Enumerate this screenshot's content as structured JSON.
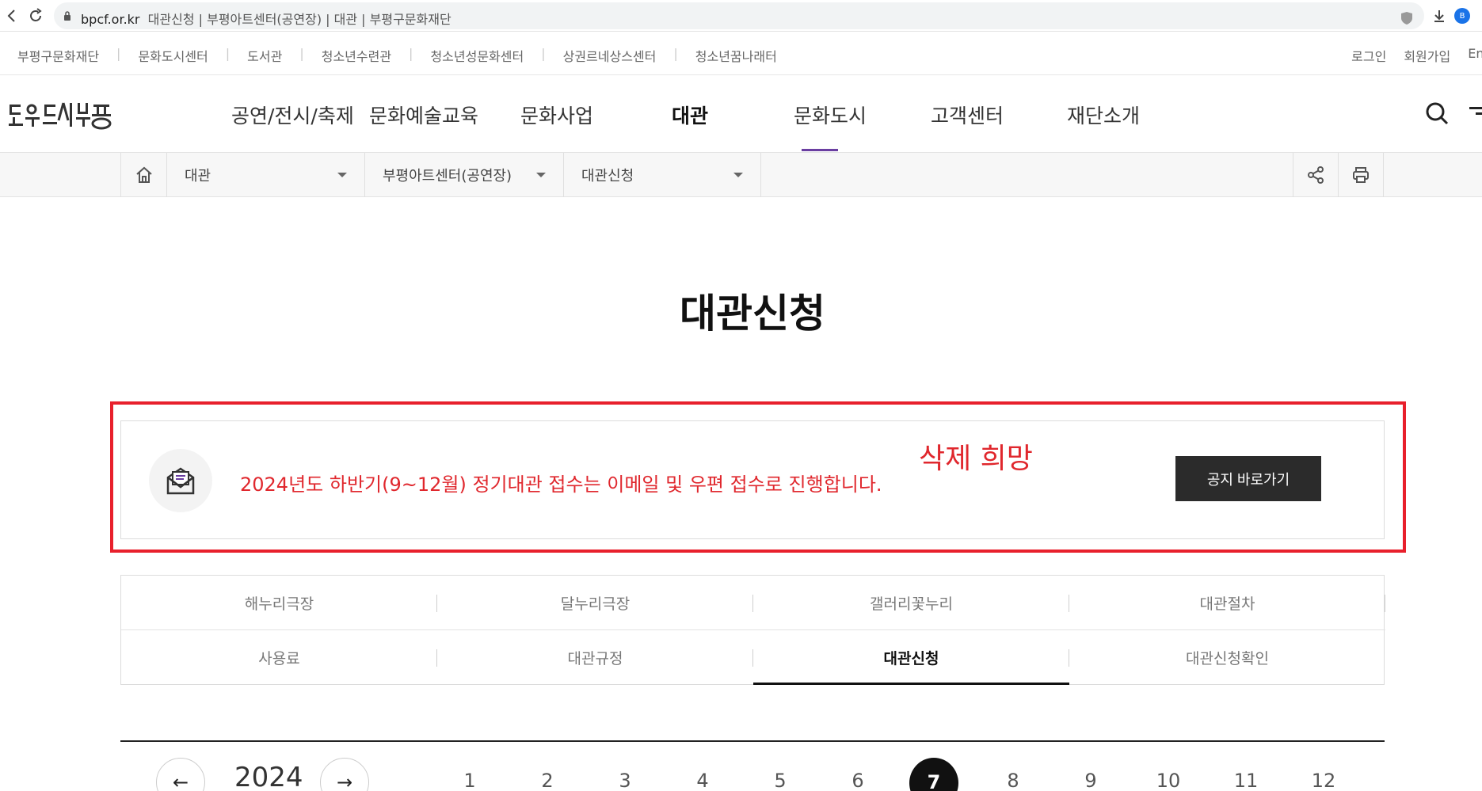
{
  "browser": {
    "url": "bpcf.or.kr",
    "page_title": "대관신청 | 부평아트센터(공연장) | 대관 | 부평구문화재단",
    "ext_badge": "B"
  },
  "util_nav": {
    "left": [
      "부평구문화재단",
      "문화도시센터",
      "도서관",
      "청소년수련관",
      "청소년성문화센터",
      "상권르네상스센터",
      "청소년꿈나래터"
    ],
    "right": [
      "로그인",
      "회원가입",
      "English"
    ]
  },
  "gnb": {
    "items": [
      "공연/전시/축제",
      "문화예술교육",
      "문화사업",
      "대관",
      "문화도시",
      "고객센터",
      "재단소개"
    ],
    "active_index": 3,
    "accent": "#6a3ea1"
  },
  "breadcrumb": {
    "level1": "대관",
    "level2": "부평아트센터(공연장)",
    "level3": "대관신청"
  },
  "page": {
    "title": "대관신청"
  },
  "notice": {
    "text": "2024년도 하반기(9~12월) 정기대관 접수는 이메일 및 우편 접수로 진행합니다.",
    "button": "공지 바로가기",
    "annotation": "삭제 희망",
    "color": "#e0272d"
  },
  "tabs": {
    "row1": [
      "해누리극장",
      "달누리극장",
      "갤러리꽃누리",
      "대관절차"
    ],
    "row2": [
      "사용료",
      "대관규정",
      "대관신청",
      "대관신청확인"
    ],
    "active": "대관신청"
  },
  "calendar": {
    "year": "2024",
    "months": [
      "1",
      "2",
      "3",
      "4",
      "5",
      "6",
      "7",
      "8",
      "9",
      "10",
      "11",
      "12"
    ],
    "active_month": "7",
    "prev": "←",
    "next": "→"
  }
}
